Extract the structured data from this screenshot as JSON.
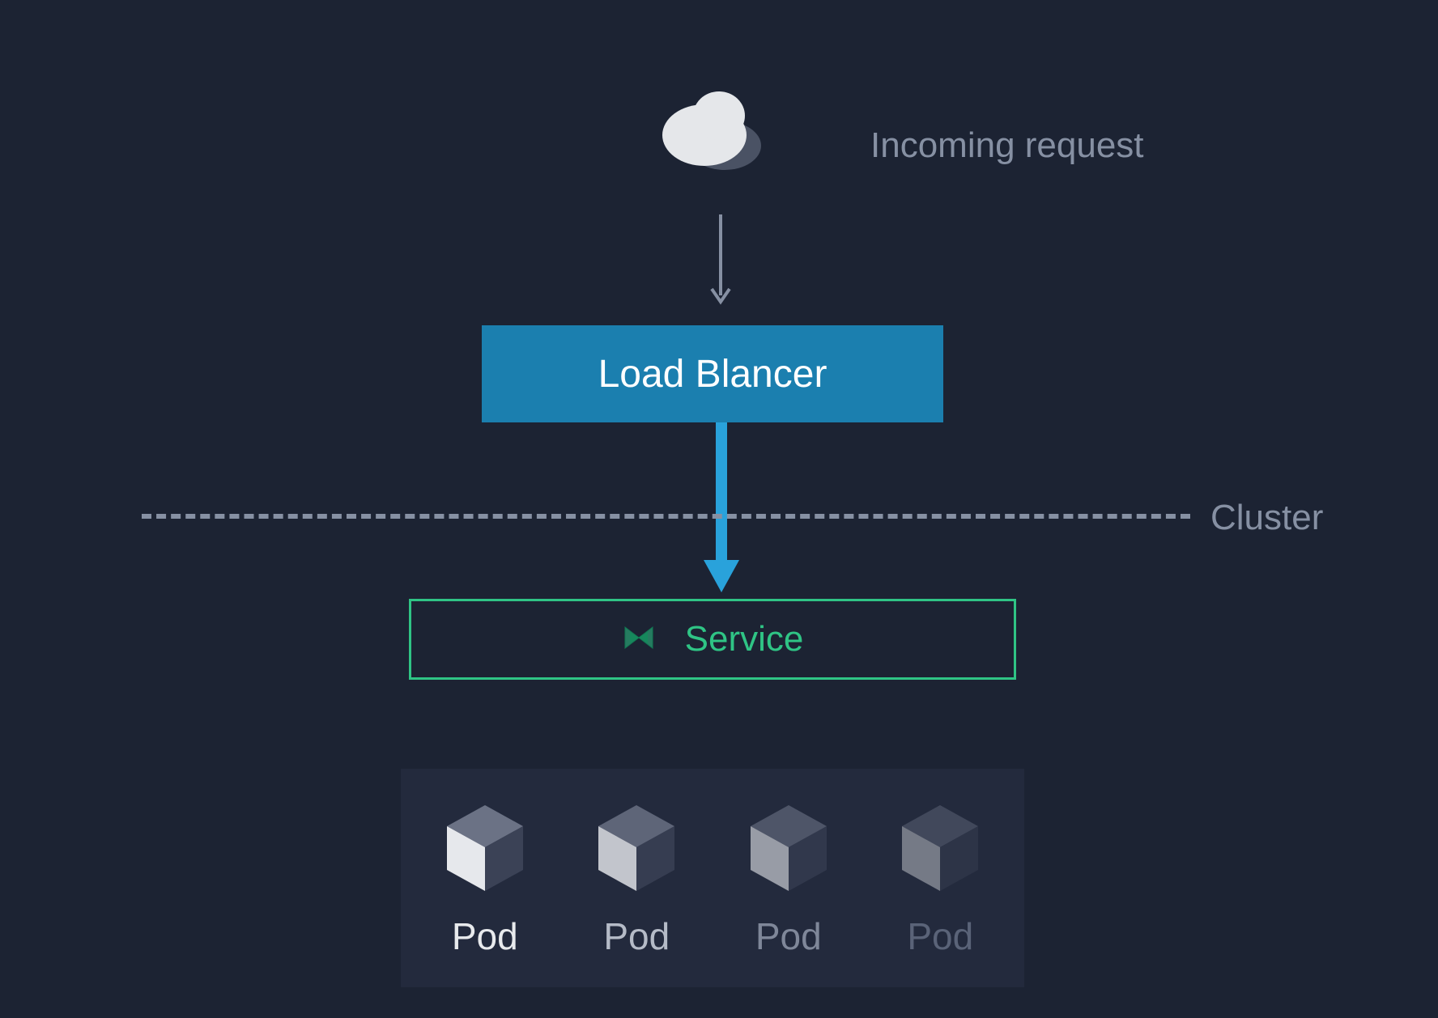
{
  "incoming_label": "Incoming request",
  "load_balancer_label": "Load Blancer",
  "cluster_label": "Cluster",
  "service_label": "Service",
  "pods": [
    {
      "label": "Pod",
      "opacity": 1.0
    },
    {
      "label": "Pod",
      "opacity": 0.82
    },
    {
      "label": "Pod",
      "opacity": 0.6
    },
    {
      "label": "Pod",
      "opacity": 0.42
    }
  ],
  "colors": {
    "background": "#1c2333",
    "muted_text": "#8690a3",
    "load_balancer": "#1b7faf",
    "service_green": "#2fc485",
    "arrow_blue": "#29a2db",
    "cloud_light": "#e5e7ea",
    "cloud_shadow": "#4a5264"
  }
}
